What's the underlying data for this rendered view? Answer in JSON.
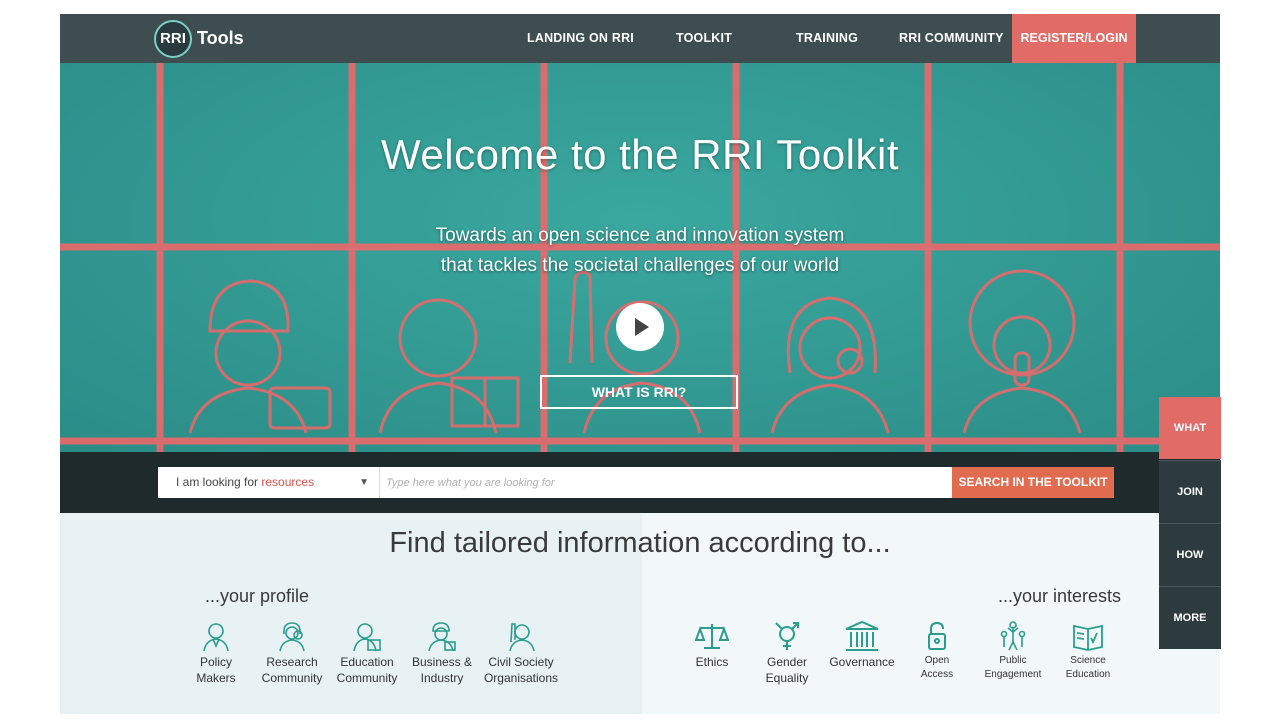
{
  "nav": {
    "logo_rri": "RRI",
    "logo_tools": "Tools",
    "items": [
      {
        "label": "LANDING ON RRI"
      },
      {
        "label": "TOOLKIT"
      },
      {
        "label": "TRAINING"
      },
      {
        "label": "RRI COMMUNITY"
      }
    ],
    "register_label": "REGISTER/LOGIN"
  },
  "hero": {
    "title": "Welcome to the RRI Toolkit",
    "subtitle_line1": "Towards an open science and innovation system",
    "subtitle_line2": "that tackles the societal challenges of our world",
    "what_is_label": "WHAT IS RRI?"
  },
  "search": {
    "select_prefix": "I am looking for",
    "select_value": "resources",
    "placeholder": "Type here what you are looking for",
    "button_label": "SEARCH IN THE TOOLKIT"
  },
  "side_tabs": [
    {
      "label": "WHAT"
    },
    {
      "label": "JOIN"
    },
    {
      "label": "HOW"
    },
    {
      "label": "MORE"
    }
  ],
  "find": {
    "title": "Find tailored information according to...",
    "profile_heading": "...your profile",
    "interests_heading": "...your interests",
    "profiles": [
      {
        "line1": "Policy",
        "line2": "Makers",
        "icon": "policy-maker-icon"
      },
      {
        "line1": "Research",
        "line2": "Community",
        "icon": "researcher-icon"
      },
      {
        "line1": "Education",
        "line2": "Community",
        "icon": "educator-icon"
      },
      {
        "line1": "Business &",
        "line2": "Industry",
        "icon": "business-icon"
      },
      {
        "line1": "Civil Society",
        "line2": "Organisations",
        "icon": "civil-society-icon"
      }
    ],
    "interests": [
      {
        "line1": "Ethics",
        "line2": "",
        "icon": "scales-icon"
      },
      {
        "line1": "Gender",
        "line2": "Equality",
        "icon": "gender-icon"
      },
      {
        "line1": "Governance",
        "line2": "",
        "icon": "building-icon"
      },
      {
        "line1": "Open",
        "line2": "Access",
        "icon": "lock-icon"
      },
      {
        "line1": "Public",
        "line2": "Engagement",
        "icon": "people-icon"
      },
      {
        "line1": "Science",
        "line2": "Education",
        "icon": "book-icon"
      }
    ]
  },
  "colors": {
    "nav_bg": "#3e4d50",
    "accent_red": "#e06b67",
    "hero_teal": "#2f9a93",
    "icon_teal": "#2a9d8f",
    "searchbar_bg": "#1f2a2d",
    "side_tab_dark": "#2e3b3e"
  }
}
